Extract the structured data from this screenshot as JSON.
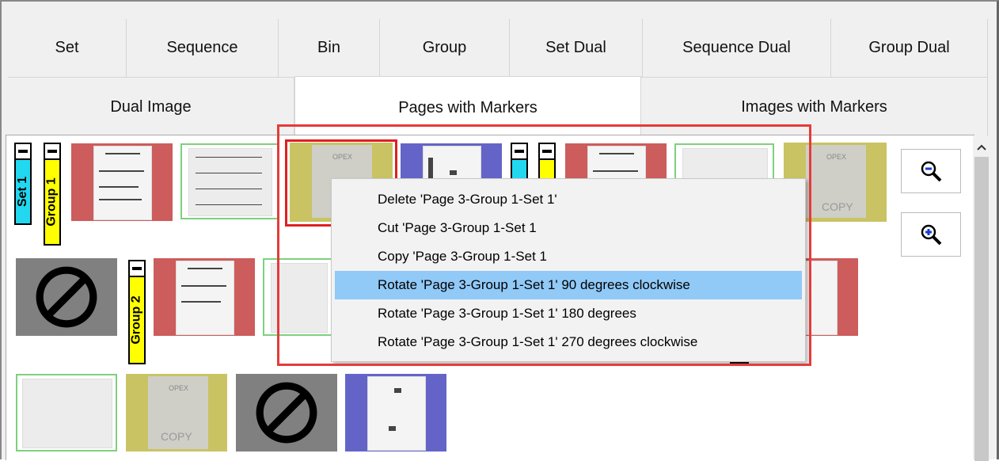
{
  "tabs_row1": [
    "Set",
    "Sequence",
    "Bin",
    "Group",
    "Set Dual",
    "Sequence Dual",
    "Group Dual"
  ],
  "tabs_row2": [
    "Dual Image",
    "Pages with Markers",
    "Images with Markers"
  ],
  "active_tab": "Pages with Markers",
  "markers": {
    "set1": "Set 1",
    "group1": "Group 1",
    "group2": "Group 2"
  },
  "thumbnail_watermark": "COPY",
  "thumbnail_header": "OPEX",
  "context_menu": [
    "Delete 'Page 3-Group 1-Set 1'",
    "Cut 'Page 3-Group 1-Set 1",
    "Copy 'Page 3-Group 1-Set 1",
    "Rotate 'Page 3-Group 1-Set 1' 90 degrees clockwise",
    "Rotate 'Page 3-Group 1-Set 1' 180 degrees",
    "Rotate 'Page 3-Group 1-Set 1' 270 degrees clockwise"
  ],
  "highlighted_menu_index": 3,
  "icons": [
    "zoom-out-icon",
    "zoom-in-icon",
    "prohibited-icon",
    "scroll-up-icon"
  ],
  "colors": {
    "red_bg": "#cd5c5c",
    "green_border": "#7ed07e",
    "olive_bg": "#c9c364",
    "blue_bg": "#6464c8",
    "cyan_marker": "#21d8f0",
    "yellow_marker": "#ffff00",
    "menu_highlight": "#91c9f7",
    "callout_red": "#e53b3b"
  }
}
